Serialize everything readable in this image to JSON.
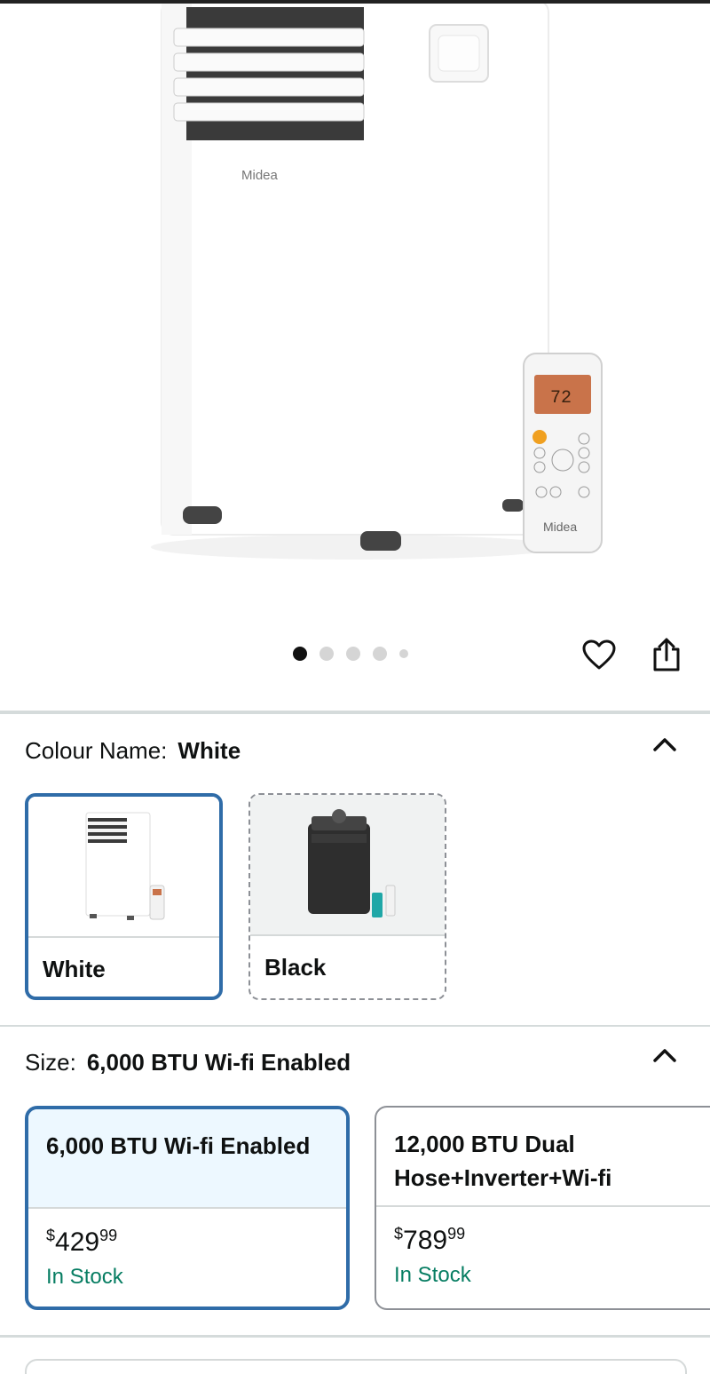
{
  "gallery": {
    "image_count": 5,
    "active_index": 0,
    "brand_text": "Midea",
    "remote_display": "72"
  },
  "actions": {
    "wishlist_icon": "heart-icon",
    "share_icon": "share-icon"
  },
  "colour": {
    "label": "Colour Name:",
    "selected": "White",
    "options": [
      {
        "name": "White",
        "state": "selected"
      },
      {
        "name": "Black",
        "state": "unavailable"
      }
    ]
  },
  "size": {
    "label": "Size:",
    "selected": "6,000 BTU Wi-fi Enabled",
    "options": [
      {
        "title": "6,000 BTU Wi-fi Enabled",
        "currency": "$",
        "price_whole": "429",
        "price_fraction": "99",
        "availability": "In Stock",
        "state": "selected"
      },
      {
        "title_line1": "12,000 BTU Dual",
        "title_line2": "Hose+Inverter+Wi-fi",
        "currency": "$",
        "price_whole": "789",
        "price_fraction": "99",
        "availability": "In Stock",
        "state": "available"
      }
    ]
  },
  "colors": {
    "selected_border": "#2f6ca8",
    "selected_bg": "#edf8ff",
    "in_stock": "#067d62"
  }
}
